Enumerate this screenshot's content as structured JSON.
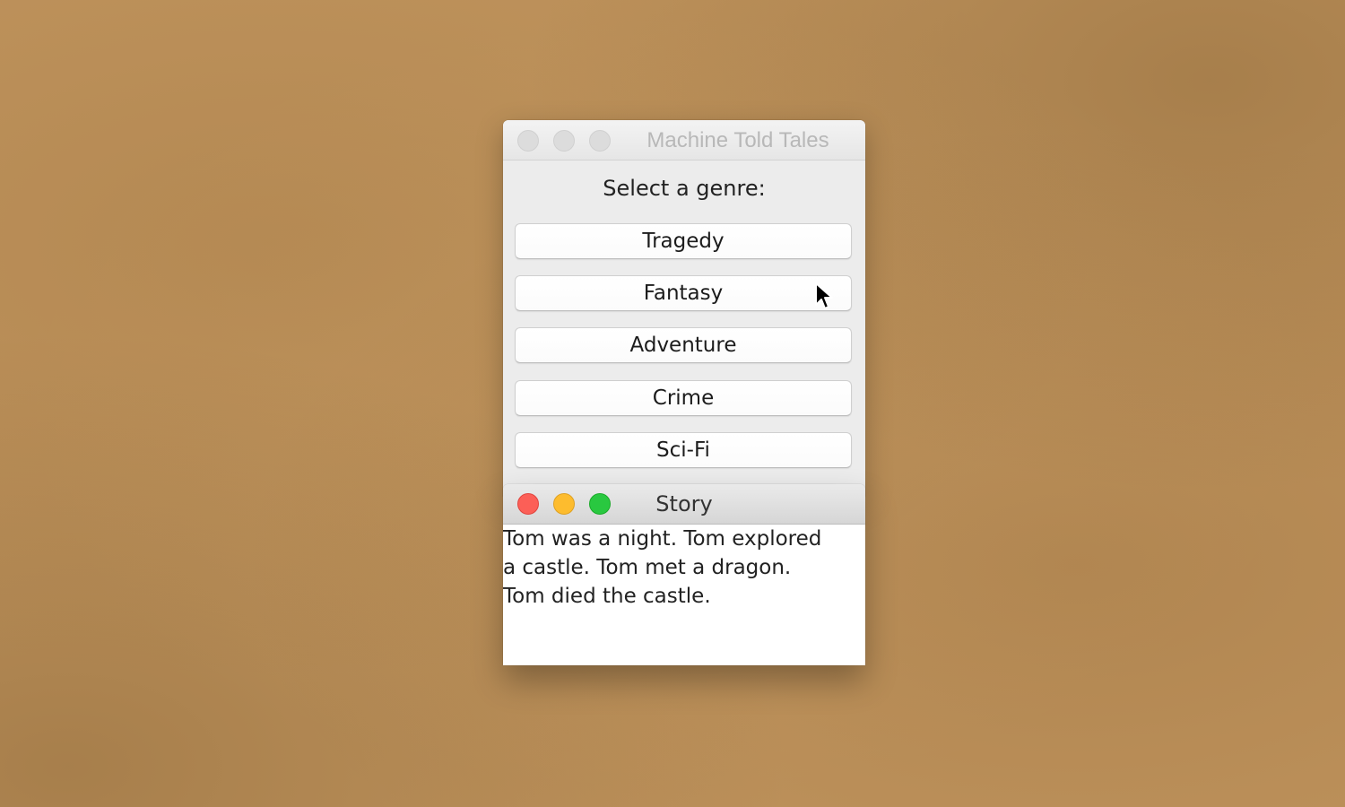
{
  "main_window": {
    "title": "Machine Told Tales",
    "prompt": "Select a genre:",
    "genres": [
      "Tragedy",
      "Fantasy",
      "Adventure",
      "Crime",
      "Sci-Fi"
    ]
  },
  "story_window": {
    "title": "Story",
    "lines": [
      "Tom was a night. Tom explored",
      "a castle. Tom met a dragon.",
      "Tom died the castle."
    ]
  },
  "colors": {
    "close": "#fc5f57",
    "minimize": "#fdbc2e",
    "zoom": "#29c840",
    "desktop": "#c1955e"
  },
  "icons": {
    "cursor": "arrow-cursor-icon"
  }
}
